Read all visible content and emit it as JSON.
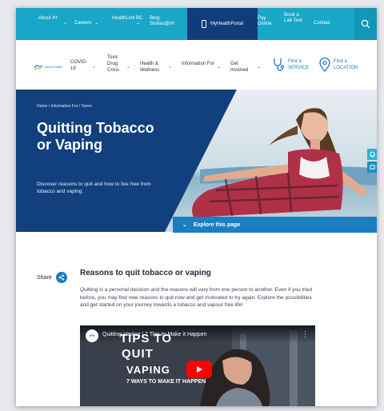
{
  "topbar": {
    "about": "About IH",
    "careers": "Careers",
    "healthlink": "HealthLink BC",
    "blog": "Blog: Stories@IH",
    "myhealthportal": "MyHealthPortal",
    "pay_online": "Pay Online",
    "book_lab": "Book a Lab Test",
    "contact": "Contact"
  },
  "nav": {
    "logo_text": "Interior Health",
    "items": [
      {
        "label": "COVID-19"
      },
      {
        "label": "Toxic Drug Crisis"
      },
      {
        "label": "Health & Wellness"
      },
      {
        "label": "Information For"
      },
      {
        "label": "Get Involved"
      }
    ],
    "find_service": "Find a SERVICE",
    "find_location": "Find a LOCATION"
  },
  "hero": {
    "breadcrumb": "Home  /  Information For  /  Teens",
    "title": "Quitting Tobacco or Vaping",
    "intro": "Discover reasons to quit and how to live free from tobacco and vaping.",
    "explore": "Explore this page"
  },
  "share_label": "Share",
  "section": {
    "title": "Reasons to quit tobacco or vaping",
    "paragraph": "Quitting is a personal decision and the reasons will vary from one person to another. Even if you tried before, you may find new reasons to quit now and get motivated to try again. Explore the possibilities and get started on your journey towards a tobacco and vapour free life!"
  },
  "video": {
    "title": "Quitting Vaping | 7 Tips to Make it Happen",
    "overlay_line1": "TIPS TO",
    "overlay_line2": "QUIT",
    "overlay_line3": "VAPING",
    "overlay_line4": "7 WAYS TO MAKE IT HAPPEN"
  },
  "colors": {
    "topbar": "#1aa6c8",
    "portal": "#0f3d7a",
    "hero_panel": "#123f7e",
    "accent": "#1a7ec0",
    "play": "#ff0000"
  }
}
